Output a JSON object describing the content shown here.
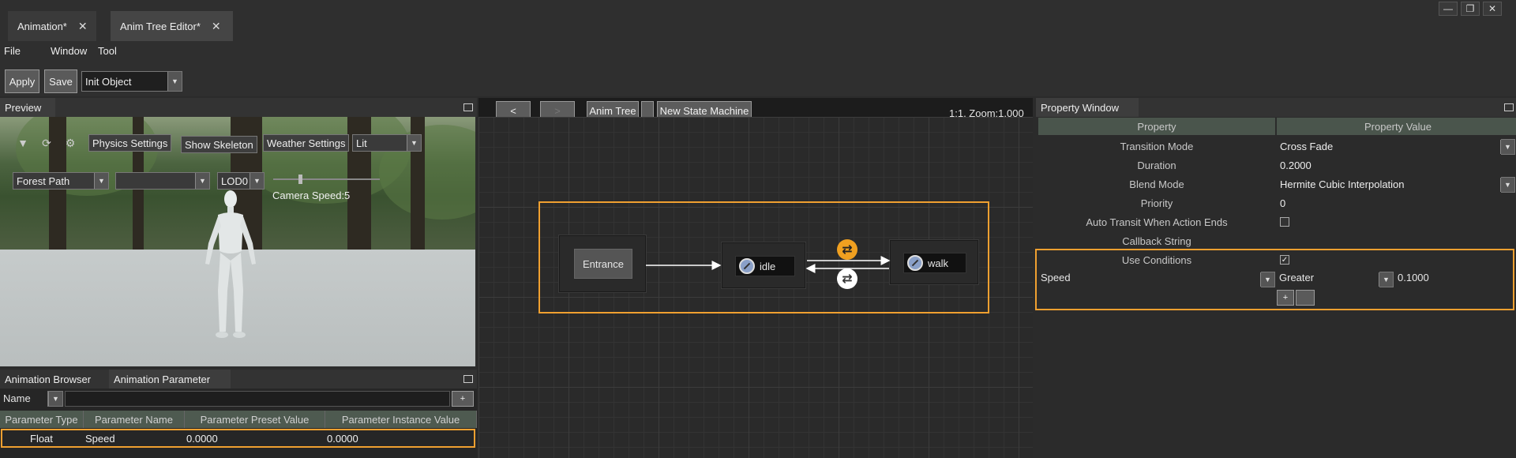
{
  "tabs": [
    {
      "label": "Animation*"
    },
    {
      "label": "Anim Tree Editor*"
    }
  ],
  "window_controls": {
    "minimize": "—",
    "restore": "❐",
    "close": "✕"
  },
  "menu": [
    "File",
    "Window",
    "Tool"
  ],
  "toolbar": {
    "apply": "Apply",
    "save": "Save",
    "object_select": "Init Object"
  },
  "preview": {
    "title": "Preview",
    "physics_settings": "Physics Settings",
    "show_skeleton": "Show Skeleton",
    "weather_settings": "Weather Settings",
    "lit": "Lit",
    "scene": "Forest Path",
    "scene2": "",
    "lod": "LOD0",
    "camera_speed": "Camera Speed:5",
    "camera_speed_level": 0.25
  },
  "browser": {
    "tabs": [
      "Animation Browser",
      "Animation Parameter"
    ],
    "filter": "Name",
    "add": "+",
    "columns": [
      "Parameter Type",
      "Parameter Name",
      "Parameter Preset Value",
      "Parameter Instance Value"
    ],
    "rows": [
      {
        "type": "Float",
        "name": "Speed",
        "preset": "0.0000",
        "instance": "0.0000"
      }
    ]
  },
  "tree": {
    "back": "<",
    "forward": ">",
    "breadcrumb1": "Anim Tree",
    "breadcrumb2": "New State Machine",
    "zoom": "1:1, Zoom:1.000",
    "entrance": "Entrance",
    "states": [
      "idle",
      "walk"
    ]
  },
  "property": {
    "title": "Property Window",
    "header": [
      "Property",
      "Property Value"
    ],
    "rows": [
      {
        "label": "Transition Mode",
        "value": "Cross Fade"
      },
      {
        "label": "Duration",
        "value": "0.2000"
      },
      {
        "label": "Blend Mode",
        "value": "Hermite Cubic Interpolation"
      },
      {
        "label": "Priority",
        "value": "0"
      },
      {
        "label": "Auto Transit When Action Ends",
        "value": ""
      },
      {
        "label": "Callback String",
        "value": ""
      },
      {
        "label": "Use Conditions",
        "value": "✓"
      }
    ],
    "condition": {
      "param": "Speed",
      "op": "Greater",
      "value": "0.1000"
    },
    "add": "+",
    "remove": ""
  },
  "colors": {
    "accent": "#f0a030",
    "table_header": "#4e5a50"
  }
}
